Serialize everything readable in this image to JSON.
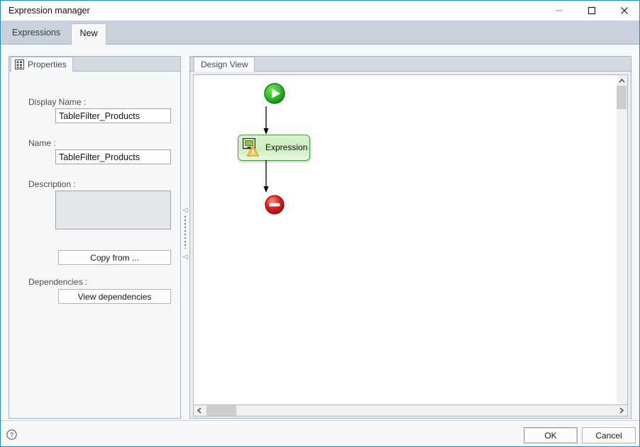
{
  "window": {
    "title": "Expression manager",
    "controls": {
      "minimize": "minimize-icon",
      "maximize": "maximize-icon",
      "close": "close-icon"
    }
  },
  "tabs": [
    {
      "label": "Expressions",
      "active": false
    },
    {
      "label": "New",
      "active": true
    }
  ],
  "properties_panel": {
    "tab_label": "Properties",
    "tab_icon": "properties-grid-icon",
    "fields": {
      "display_name_label": "Display Name :",
      "display_name_value": "TableFilter_Products",
      "name_label": "Name :",
      "name_value": "TableFilter_Products",
      "description_label": "Description :",
      "description_value": "",
      "description_placeholder": "",
      "dependencies_label": "Dependencies :"
    },
    "buttons": {
      "copy_from": "Copy from ...",
      "view_dependencies": "View dependencies"
    }
  },
  "splitter": {
    "collapse_left_icon": "chevron-left-icon",
    "collapse_left_icon_2": "chevron-left-icon",
    "grip": "splitter-grip"
  },
  "design_panel": {
    "tab_label": "Design View",
    "nodes": [
      {
        "id": "start",
        "type": "start-node",
        "label": "",
        "icon": "play-icon"
      },
      {
        "id": "expression",
        "type": "activity-node",
        "label": "Expression",
        "icon": "monitor-icon",
        "overlay_icon": "warning-triangle-icon"
      },
      {
        "id": "stop",
        "type": "stop-node",
        "label": "",
        "icon": "stop-icon"
      }
    ],
    "connectors": [
      {
        "from": "start",
        "to": "expression"
      },
      {
        "from": "expression",
        "to": "stop"
      }
    ],
    "vertical_scrollbar": {
      "up_icon": "chevron-up-icon",
      "down_icon": "chevron-down-icon"
    },
    "horizontal_scrollbar": {
      "left_icon": "chevron-left-icon",
      "right_icon": "chevron-right-icon"
    }
  },
  "footer": {
    "help_icon": "help-circle-icon",
    "ok": "OK",
    "cancel": "Cancel"
  },
  "colors": {
    "accent_border": "#1d8bcd",
    "tabstrip": "#c9d2da",
    "node_green_border": "#4f9a4f",
    "node_green_fill": "#cdeec0",
    "start_green": "#22a322",
    "stop_red": "#d81f1f",
    "warning_orange": "#f5a623"
  }
}
